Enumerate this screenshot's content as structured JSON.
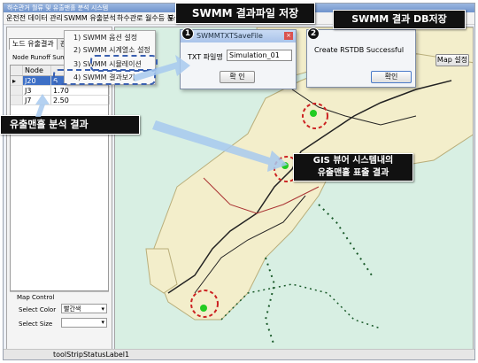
{
  "window": {
    "title": "하수관거 월류 및 유출맨홀 분석 시스템"
  },
  "menu": [
    "운전전 데이터 관리",
    "SWMM 유출분석",
    "하수관로 월수등 분석",
    "도",
    "모"
  ],
  "tabs": [
    "노드 유출결과",
    "관기"
  ],
  "grid": {
    "caption": "Node Runoff Sum",
    "header": "Node",
    "rows": [
      {
        "node": "J20",
        "value": "6"
      },
      {
        "node": "J3",
        "value": "1.70"
      },
      {
        "node": "J7",
        "value": "2.50"
      }
    ]
  },
  "submenu": {
    "items": [
      "1) SWMM 옵션 설정",
      "2) SWMM 시계열소 설정",
      "3) SWMM 시뮬레이션",
      "4) SWMM 결과보기"
    ]
  },
  "map_control": {
    "title": "Map Control",
    "color_label": "Select Color",
    "color_value": "빨간색",
    "size_label": "Select Size"
  },
  "map_button": "Map 설정",
  "status": {
    "label": "toolStripStatusLabel1"
  },
  "callouts": {
    "txt_save": "SWMM 결과파일 저장",
    "db_save": "SWMM 결과 DB저장",
    "runoff_result": "유출맨홀 분석 결과",
    "gis_result_line1": "GIS 뷰어 시스템내의",
    "gis_result_line2": "유출맨홀 표출 결과"
  },
  "dialog1": {
    "badge": "1",
    "title": "SWMMTXTSaveFile",
    "field_label": "TXT 파일명",
    "field_value": "Simulation_01",
    "ok": "확 인"
  },
  "dialog2": {
    "badge": "2",
    "message": "Create RSTDB Successful",
    "ok": "확인"
  },
  "colors": {
    "map_bg": "#d8efe3",
    "accent_red": "#cc2222",
    "highlight_green": "#22cc22"
  }
}
